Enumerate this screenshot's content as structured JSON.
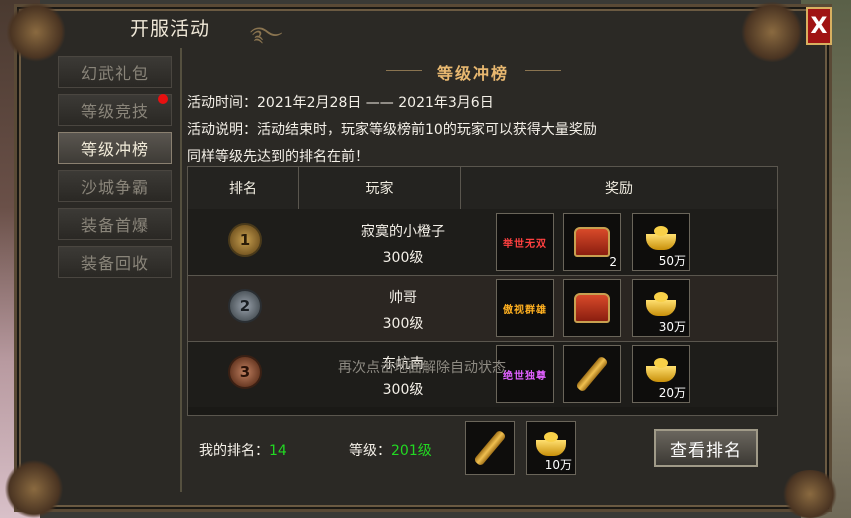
{
  "window": {
    "title": "开服活动",
    "close": "X"
  },
  "sidebar": {
    "items": [
      {
        "label": "幻武礼包",
        "active": false
      },
      {
        "label": "等级竞技",
        "active": false
      },
      {
        "label": "等级冲榜",
        "active": true
      },
      {
        "label": "沙城争霸",
        "active": false
      },
      {
        "label": "装备首爆",
        "active": false
      },
      {
        "label": "装备回收",
        "active": false
      }
    ]
  },
  "content": {
    "header": "等级冲榜",
    "time": "活动时间：2021年2月28日 —— 2021年3月6日",
    "desc": "活动说明：活动结束时，玩家等级榜前10的玩家可以获得大量奖励",
    "note": "同样等级先达到的排名在前！"
  },
  "table": {
    "headers": [
      "排名",
      "玩家",
      "奖励"
    ],
    "rows": [
      {
        "rank": "1",
        "name": "寂寞的小橙子",
        "level": "300级",
        "title_item": "举世无双",
        "chest_count": "2",
        "gold": "50万"
      },
      {
        "rank": "2",
        "name": "帅哥",
        "level": "300级",
        "title_item": "傲视群雄",
        "gold": "30万"
      },
      {
        "rank": "3",
        "name": "东坑南",
        "level": "300级",
        "title_item": "绝世独尊",
        "gold": "20万"
      }
    ]
  },
  "overlay": "再次点击地面解除自动状态",
  "mine": {
    "rank_label": "我的排名：",
    "rank": "14",
    "level_label": "等级：",
    "level": "201级",
    "gold": "10万"
  },
  "view_button": "查看排名",
  "colors": {
    "accent": "#e8b870",
    "green": "#22d822",
    "close": "#a01414"
  }
}
